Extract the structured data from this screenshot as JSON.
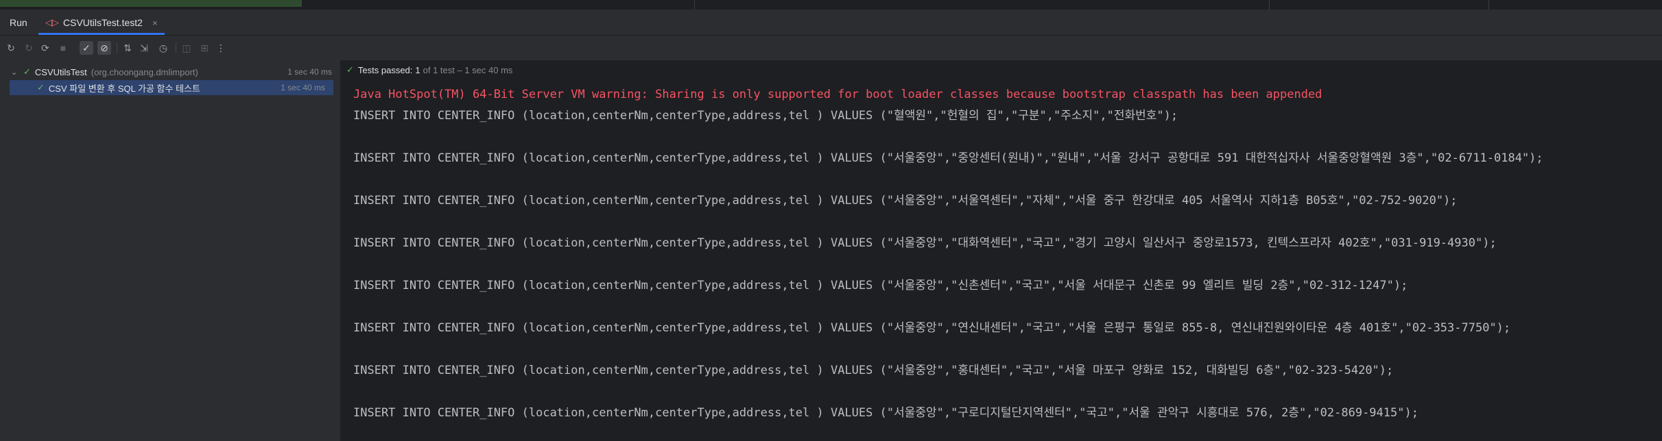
{
  "run_panel": {
    "title": "Run",
    "tab": {
      "label": "CSVUtilsTest.test2",
      "icon": "test-run-icon",
      "close": "×"
    }
  },
  "toolbar": {
    "icons": [
      "rerun-icon",
      "rerun-failed-icon",
      "toggle-auto-test-icon",
      "stop-icon",
      "show-passed-icon",
      "show-ignored-icon",
      "sort-alpha-icon",
      "sort-duration-icon",
      "history-icon",
      "camera-icon",
      "export-icon",
      "more-icon"
    ]
  },
  "test_tree": {
    "root": {
      "name": "CSVUtilsTest",
      "package": "(org.choongang.dmlimport)",
      "time": "1 sec 40 ms"
    },
    "child": {
      "name": "CSV 파일 변환 후 SQL 가공 함수 테스트",
      "time": "1 sec 40 ms"
    }
  },
  "status": {
    "label": "Tests passed:",
    "count": "1",
    "detail": "of 1 test – 1 sec 40 ms"
  },
  "console": {
    "warning": "Java HotSpot(TM) 64-Bit Server VM warning: Sharing is only supported for boot loader classes because bootstrap classpath has been appended",
    "lines": [
      "INSERT INTO CENTER_INFO (location,centerNm,centerType,address,tel ) VALUES (\"혈액원\",\"헌혈의 집\",\"구분\",\"주소지\",\"전화번호\");",
      "INSERT INTO CENTER_INFO (location,centerNm,centerType,address,tel ) VALUES (\"서울중앙\",\"중앙센터(원내)\",\"원내\",\"서울 강서구 공항대로 591 대한적십자사 서울중앙혈액원 3층\",\"02-6711-0184\");",
      "INSERT INTO CENTER_INFO (location,centerNm,centerType,address,tel ) VALUES (\"서울중앙\",\"서울역센터\",\"자체\",\"서울 중구 한강대로 405 서울역사 지하1층 B05호\",\"02-752-9020\");",
      "INSERT INTO CENTER_INFO (location,centerNm,centerType,address,tel ) VALUES (\"서울중앙\",\"대화역센터\",\"국고\",\"경기 고양시 일산서구 중앙로1573, 킨텍스프라자 402호\",\"031-919-4930\");",
      "INSERT INTO CENTER_INFO (location,centerNm,centerType,address,tel ) VALUES (\"서울중앙\",\"신촌센터\",\"국고\",\"서울 서대문구 신촌로 99 엘리트 빌딩 2층\",\"02-312-1247\");",
      "INSERT INTO CENTER_INFO (location,centerNm,centerType,address,tel ) VALUES (\"서울중앙\",\"연신내센터\",\"국고\",\"서울 은평구 통일로 855-8, 연신내진원와이타운 4층 401호\",\"02-353-7750\");",
      "INSERT INTO CENTER_INFO (location,centerNm,centerType,address,tel ) VALUES (\"서울중앙\",\"홍대센터\",\"국고\",\"서울 마포구 양화로 152, 대화빌딩 6층\",\"02-323-5420\");",
      "INSERT INTO CENTER_INFO (location,centerNm,centerType,address,tel ) VALUES (\"서울중앙\",\"구로디지털단지역센터\",\"국고\",\"서울 관악구 시흥대로 576, 2층\",\"02-869-9415\");"
    ]
  },
  "colors": {
    "accent": "#3574f0",
    "pass": "#5fb865",
    "warning": "#f75464",
    "selection": "#2e436e"
  }
}
